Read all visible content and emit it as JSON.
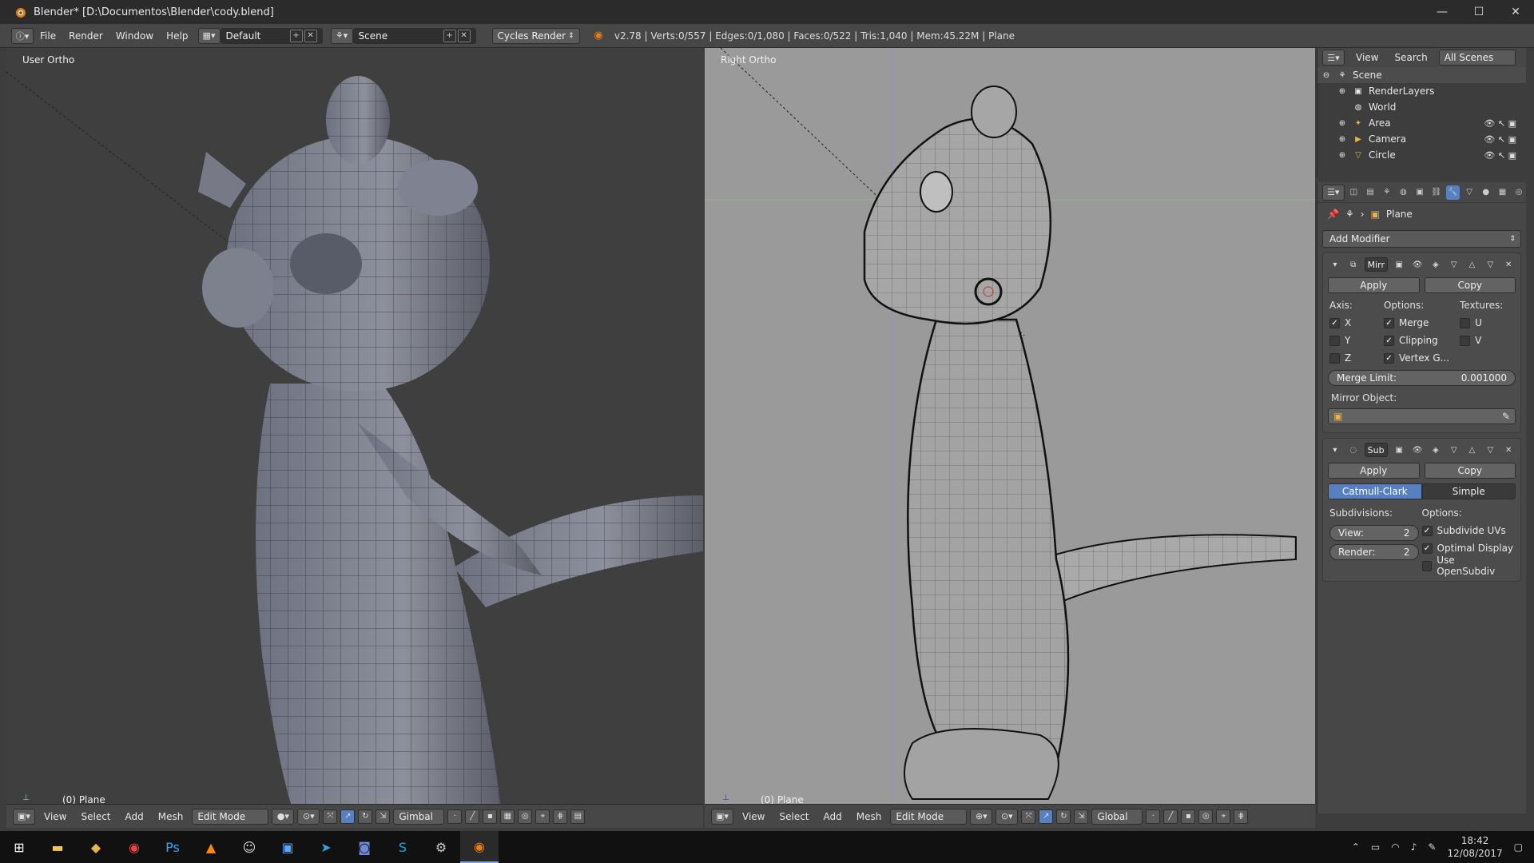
{
  "window": {
    "title": "Blender* [D:\\Documentos\\Blender\\cody.blend]",
    "min": "—",
    "max": "☐",
    "close": "✕"
  },
  "info": {
    "menus": [
      "File",
      "Render",
      "Window",
      "Help"
    ],
    "layout": "Default",
    "scene": "Scene",
    "engine": "Cycles Render",
    "stats": "v2.78 | Verts:0/557 | Edges:0/1,080 | Faces:0/522 | Tris:1,040 | Mem:45.22M | Plane"
  },
  "viewport_left": {
    "label": "User Ortho",
    "object": "(0) Plane",
    "footer": {
      "menus": [
        "View",
        "Select",
        "Add",
        "Mesh"
      ],
      "mode": "Edit Mode",
      "orientation": "Gimbal"
    }
  },
  "viewport_right": {
    "label": "Right Ortho",
    "object": "(0) Plane",
    "footer": {
      "menus": [
        "View",
        "Select",
        "Add",
        "Mesh"
      ],
      "mode": "Edit Mode",
      "orientation": "Global"
    }
  },
  "outliner": {
    "header": {
      "view": "View",
      "search": "Search",
      "filter": "All Scenes"
    },
    "items": [
      {
        "label": "Scene",
        "icon": "scene-icon"
      },
      {
        "label": "RenderLayers",
        "icon": "renderlayers-icon"
      },
      {
        "label": "World",
        "icon": "world-icon"
      },
      {
        "label": "Area",
        "icon": "lamp-icon"
      },
      {
        "label": "Camera",
        "icon": "camera-icon"
      },
      {
        "label": "Circle",
        "icon": "mesh-icon"
      }
    ]
  },
  "properties": {
    "context_object": "Plane",
    "add_modifier": "Add Modifier",
    "mirror": {
      "name": "Mirr",
      "apply": "Apply",
      "copy": "Copy",
      "axis_label": "Axis:",
      "options_label": "Options:",
      "textures_label": "Textures:",
      "axis": [
        {
          "label": "X",
          "checked": true
        },
        {
          "label": "Y",
          "checked": false
        },
        {
          "label": "Z",
          "checked": false
        }
      ],
      "options": [
        {
          "label": "Merge",
          "checked": true
        },
        {
          "label": "Clipping",
          "checked": true
        },
        {
          "label": "Vertex G...",
          "checked": true
        }
      ],
      "textures": [
        {
          "label": "U",
          "checked": false
        },
        {
          "label": "V",
          "checked": false
        }
      ],
      "merge_limit_label": "Merge Limit:",
      "merge_limit_value": "0.001000",
      "mirror_object_label": "Mirror Object:"
    },
    "subsurf": {
      "name": "Sub",
      "apply": "Apply",
      "copy": "Copy",
      "type_catmull": "Catmull-Clark",
      "type_simple": "Simple",
      "subdivisions_label": "Subdivisions:",
      "options_label": "Options:",
      "view_label": "View:",
      "view_value": "2",
      "render_label": "Render:",
      "render_value": "2",
      "options": [
        {
          "label": "Subdivide UVs",
          "checked": true
        },
        {
          "label": "Optimal Display",
          "checked": true
        },
        {
          "label": "Use OpenSubdiv",
          "checked": false
        }
      ]
    }
  },
  "taskbar": {
    "time": "18:42",
    "date": "12/08/2017"
  }
}
